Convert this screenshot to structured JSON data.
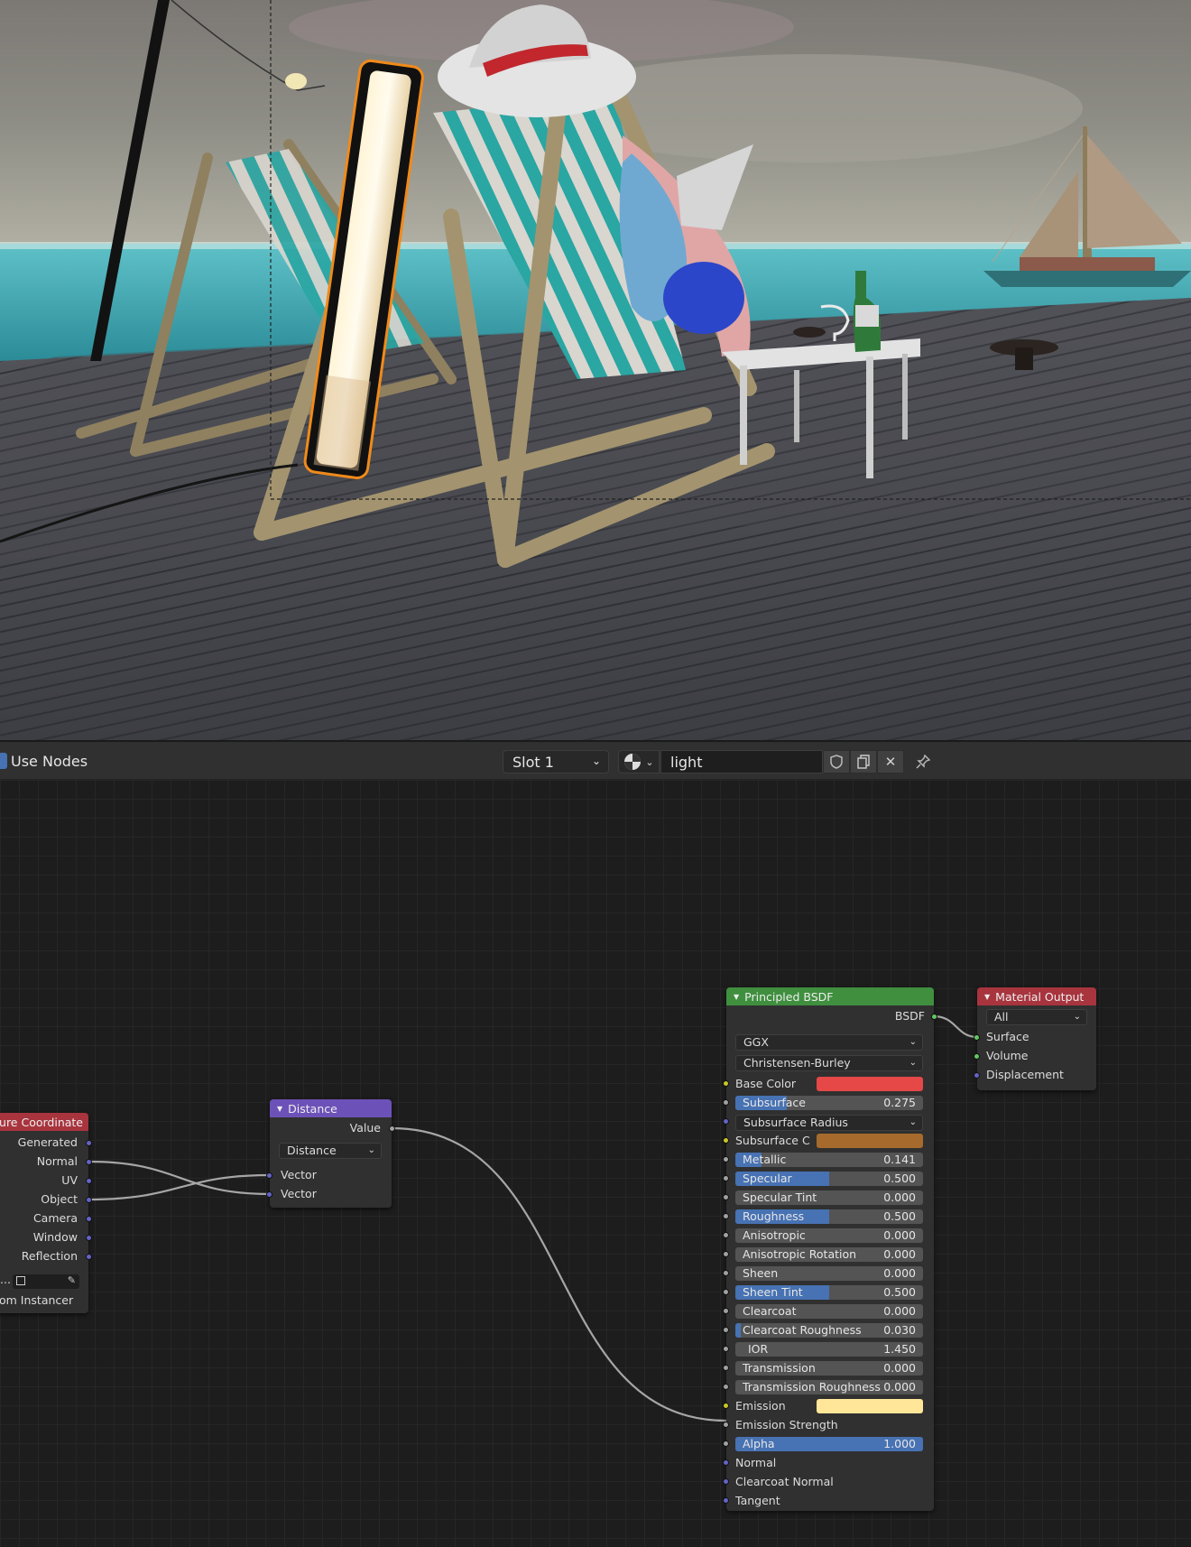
{
  "header": {
    "use_nodes_label": "Use Nodes",
    "slot_label": "Slot 1",
    "material_name": "light"
  },
  "texcoord_node": {
    "title": "xture Coordinate",
    "outputs": [
      "Generated",
      "Normal",
      "UV",
      "Object",
      "Camera",
      "Window",
      "Reflection"
    ],
    "object_field_prefix": "...",
    "from_instancer": "om Instancer"
  },
  "distance_node": {
    "title": "Distance",
    "output": "Value",
    "operation": "Distance",
    "inputs": [
      "Vector",
      "Vector"
    ]
  },
  "bsdf_node": {
    "title": "Principled BSDF",
    "output": "BSDF",
    "distribution": "GGX",
    "subsurface_method": "Christensen-Burley",
    "base_color_label": "Base Color",
    "base_color": "#e64747",
    "subsurface": {
      "label": "Subsurface",
      "value": "0.275",
      "fraction": 0.275
    },
    "subsurface_radius_label": "Subsurface Radius",
    "subsurface_color_label": "Subsurface C",
    "subsurface_color": "#a66b2c",
    "fields": [
      {
        "label": "Metallic",
        "value": "0.141",
        "fraction": 0.141
      },
      {
        "label": "Specular",
        "value": "0.500",
        "fraction": 0.5
      },
      {
        "label": "Specular Tint",
        "value": "0.000",
        "fraction": 0
      },
      {
        "label": "Roughness",
        "value": "0.500",
        "fraction": 0.5
      },
      {
        "label": "Anisotropic",
        "value": "0.000",
        "fraction": 0
      },
      {
        "label": "Anisotropic Rotation",
        "value": "0.000",
        "fraction": 0
      },
      {
        "label": "Sheen",
        "value": "0.000",
        "fraction": 0
      },
      {
        "label": "Sheen Tint",
        "value": "0.500",
        "fraction": 0.5
      },
      {
        "label": "Clearcoat",
        "value": "0.000",
        "fraction": 0
      },
      {
        "label": "Clearcoat Roughness",
        "value": "0.030",
        "fraction": 0.03
      },
      {
        "label": "IOR",
        "value": "1.450",
        "fraction": 0
      },
      {
        "label": "Transmission",
        "value": "0.000",
        "fraction": 0
      },
      {
        "label": "Transmission Roughness",
        "value": "0.000",
        "fraction": 0
      }
    ],
    "emission_label": "Emission",
    "emission_color": "#ffe699",
    "emission_strength_label": "Emission Strength",
    "alpha": {
      "label": "Alpha",
      "value": "1.000",
      "fraction": 1
    },
    "normal_label": "Normal",
    "clearcoat_normal_label": "Clearcoat Normal",
    "tangent_label": "Tangent"
  },
  "output_node": {
    "title": "Material Output",
    "target": "All",
    "inputs": [
      "Surface",
      "Volume",
      "Displacement"
    ]
  },
  "colors": {
    "texcoord_header": "#a8343e",
    "distance_header": "#6c52b8",
    "bsdf_header": "#3f8f3f",
    "output_header": "#a8343e",
    "accent": "#4772b3"
  }
}
